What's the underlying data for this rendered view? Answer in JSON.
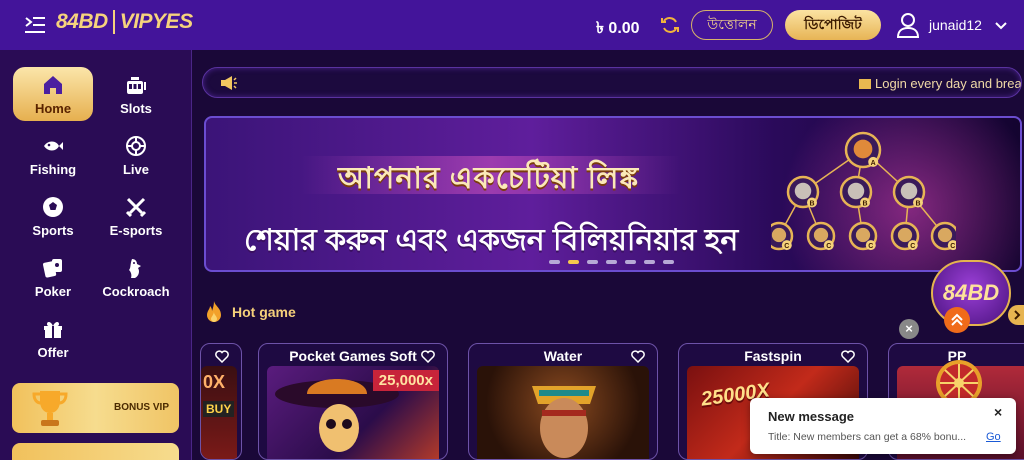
{
  "header": {
    "logo_left": "84BD",
    "logo_right": "VIPYES",
    "balance": "৳ 0.00",
    "withdraw_label": "উত্তোলন",
    "deposit_label": "ডিপোজিট",
    "username": "junaid12"
  },
  "sidebar": {
    "items": [
      {
        "label": "Home",
        "icon": "home-icon"
      },
      {
        "label": "Slots",
        "icon": "slot-machine-icon"
      },
      {
        "label": "Fishing",
        "icon": "fish-icon"
      },
      {
        "label": "Live",
        "icon": "roulette-icon"
      },
      {
        "label": "Sports",
        "icon": "soccer-ball-icon"
      },
      {
        "label": "E-sports",
        "icon": "swords-icon"
      },
      {
        "label": "Poker",
        "icon": "cards-icon"
      },
      {
        "label": "Cockroach",
        "icon": "rooster-icon"
      },
      {
        "label": "Offer",
        "icon": "gift-icon"
      }
    ],
    "bonus_label": "BONUS VIP"
  },
  "marquee": {
    "text": "Login every day and brea"
  },
  "banner": {
    "line1": "আপনার একচেটিয়া লিঙ্ক",
    "line2": "শেয়ার করুন এবং একজন বিলিয়নিয়ার হন",
    "tree_labels": [
      "A",
      "B",
      "B",
      "B",
      "C",
      "C",
      "C",
      "C",
      "C"
    ],
    "slide_count": 7,
    "active_slide": 2
  },
  "float_logo": "84BD",
  "hot_game": {
    "title": "Hot game",
    "cards": [
      {
        "title": "",
        "badge": "0X",
        "badge2": "BUY"
      },
      {
        "title": "Pocket Games Soft",
        "badge": "25,000x"
      },
      {
        "title": "Water",
        "badge": ""
      },
      {
        "title": "Fastspin",
        "badge": "25000X"
      },
      {
        "title": "PP",
        "badge": ""
      }
    ]
  },
  "toast": {
    "title": "New message",
    "body": "Title: New members can get a 68% bonu...",
    "link": "Go",
    "close": "×"
  },
  "colors": {
    "header_bg": "#43149a",
    "sidebar_bg": "#2a0c55",
    "accent_gold": "#e7b455",
    "page_bg": "#1a0838"
  }
}
